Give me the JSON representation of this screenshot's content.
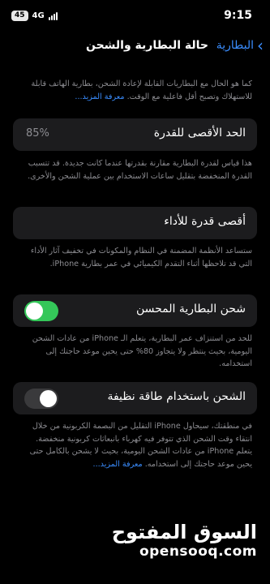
{
  "status_bar": {
    "battery": "45",
    "network": "4G",
    "time": "9:15"
  },
  "nav": {
    "back_label": "البطارية",
    "title": "حالة البطارية والشحن"
  },
  "intro": {
    "text": "كما هو الحال مع البطاريات القابلة لإعادة الشحن، بطارية الهاتف قابلة للاستهلاك وتصبح أقل فاعلية مع الوقت.",
    "link": "معرفة المزيد..."
  },
  "max_capacity": {
    "label": "الحد الأقصى للقدرة",
    "value": "85%",
    "desc": "هذا قياس لقدرة البطارية مقارنة بقدرتها عندما كانت جديدة. قد تتسبب القدرة المنخفضة بتقليل ساعات الاستخدام بين عملية الشحن والأخرى."
  },
  "peak_performance": {
    "label": "أقصى قدرة للأداء",
    "desc": "ستساعد الأنظمة المضمنة في النظام والمكونات في تخفيف آثار الأداء التي قد تلاحظها أثناء التقدم الكيميائي في عمر بطارية iPhone."
  },
  "optimized_charging": {
    "label": "شحن البطارية المحسن",
    "enabled": true,
    "desc": "للحد من استنزاف عمر البطارية، يتعلم الـ iPhone من عادات الشحن اليومية، بحيث ينتظر ولا يتجاوز 80% حتى يحين موعد حاجتك إلى استخدامه."
  },
  "clean_energy": {
    "label": "الشحن باستخدام طاقة نظيفة",
    "enabled": false,
    "desc": "في منطقتك، سيحاول iPhone التقليل من البصمة الكربونية من خلال انتقاء وقت الشحن الذي تتوفر فيه كهرباء بانبعاثات كربونية منخفضة. يتعلم iPhone من عادات الشحن اليومية، بحيث لا يشحن بالكامل حتى يحين موعد حاجتك إلى استخدامه.",
    "link": "معرفة المزيد..."
  },
  "watermark": {
    "arabic": "السوق المفتوح",
    "latin": "opensooq.com"
  },
  "colors": {
    "accent": "#3a8dff",
    "toggle_on": "#34c759",
    "row_bg": "#1c1c1e",
    "secondary_text": "#8d8d92"
  }
}
